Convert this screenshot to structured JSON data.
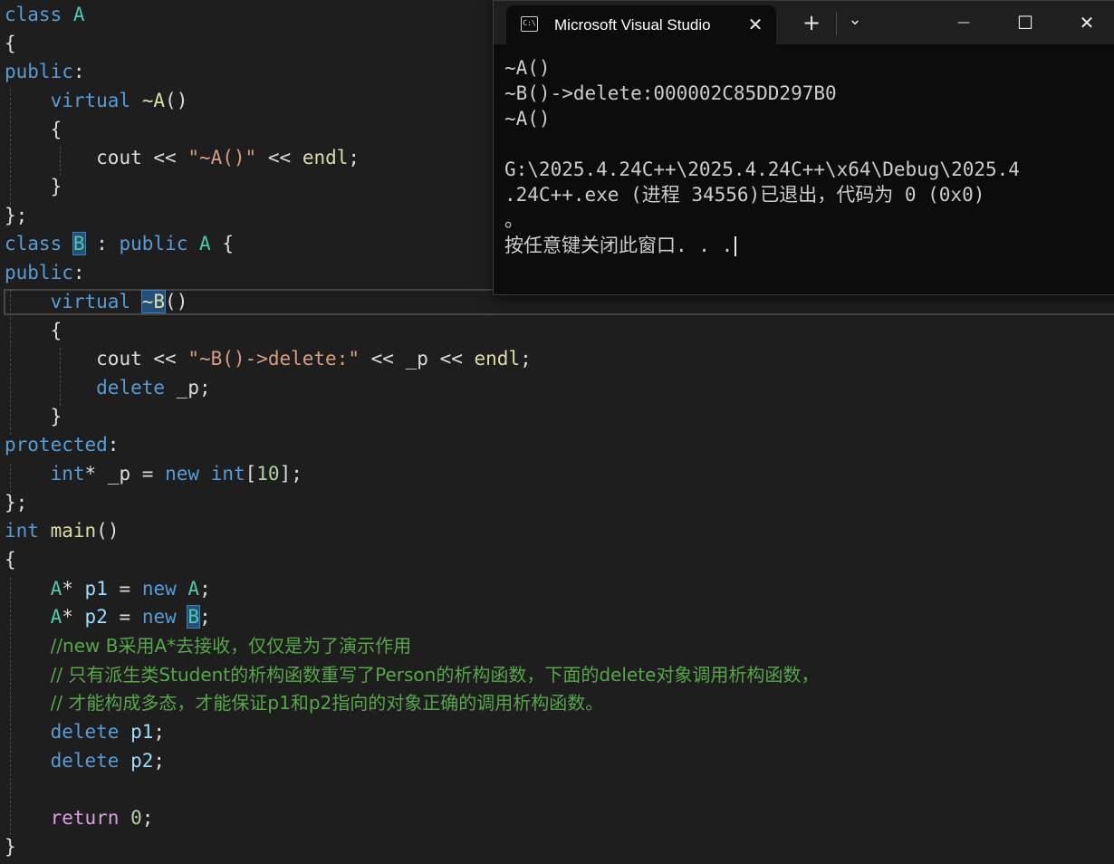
{
  "code": {
    "l1_kw": "class",
    "l1_name": "A",
    "l2": "{",
    "l3_kw": "public",
    "l3_colon": ":",
    "l4_kw": "virtual",
    "l4_fn": "~A",
    "l4_paren": "()",
    "l5": "{",
    "l6_cout": "cout",
    "l6_op": "<<",
    "l6_str": "\"~A()\"",
    "l6_op2": "<<",
    "l6_endl": "endl",
    "l6_semi": ";",
    "l7": "}",
    "l8": "};",
    "l9_kw": "class",
    "l9_name": "B",
    "l9_colon": ":",
    "l9_pub": "public",
    "l9_base": "A",
    "l9_brace": "{",
    "l10_kw": "public",
    "l10_colon": ":",
    "l11_kw": "virtual",
    "l11_fn": "~B",
    "l11_paren": "()",
    "l12": "{",
    "l13_cout": "cout",
    "l13_op": "<<",
    "l13_str": "\"~B()->delete:\"",
    "l13_op2": "<<",
    "l13_p": "_p",
    "l13_op3": "<<",
    "l13_endl": "endl",
    "l13_semi": ";",
    "l14_kw": "delete",
    "l14_p": "_p",
    "l14_semi": ";",
    "l15": "}",
    "l16_kw": "protected",
    "l16_colon": ":",
    "l17_type": "int",
    "l17_star": "*",
    "l17_var": "_p",
    "l17_eq": "=",
    "l17_new": "new",
    "l17_type2": "int",
    "l17_b1": "[",
    "l17_num": "10",
    "l17_b2": "];",
    "l18": "};",
    "l19_kw": "int",
    "l19_fn": "main",
    "l19_paren": "()",
    "l20": "{",
    "l21_cls": "A",
    "l21_star": "*",
    "l21_var": "p1",
    "l21_eq": "=",
    "l21_new": "new",
    "l21_cls2": "A",
    "l21_semi": ";",
    "l22_cls": "A",
    "l22_star": "*",
    "l22_var": "p2",
    "l22_eq": "=",
    "l22_new": "new",
    "l22_cls2": "B",
    "l22_semi": ";",
    "l23_comment": "//new B采用A*去接收，仅仅是为了演示作用",
    "l24_comment": "// 只有派生类Student的析构函数重写了Person的析构函数，下面的delete对象调用析构函数，",
    "l25_comment": "// 才能构成多态，才能保证p1和p2指向的对象正确的调用析构函数。",
    "l26_kw": "delete",
    "l26_var": "p1",
    "l26_semi": ";",
    "l27_kw": "delete",
    "l27_var": "p2",
    "l27_semi": ";",
    "l29_kw": "return",
    "l29_num": "0",
    "l29_semi": ";",
    "l30": "}"
  },
  "terminal": {
    "tab_icon_text": "C:\\",
    "tab_title": "Microsoft Visual Studio",
    "tab_close": "✕",
    "new_tab": "+",
    "dropdown": "⌄",
    "minimize": "—",
    "maximize": "☐",
    "close": "✕",
    "output": [
      "~A()",
      "~B()->delete:000002C85DD297B0",
      "~A()",
      "",
      "G:\\2025.4.24C++\\2025.4.24C++\\x64\\Debug\\2025.4",
      ".24C++.exe (进程 34556)已退出，代码为 0 (0x0)",
      "。",
      "按任意键关闭此窗口. . ."
    ]
  },
  "colors": {
    "editor_bg": "#1e1e1e",
    "keyword": "#569cd6",
    "type": "#4ec9b0",
    "function": "#dcdcaa",
    "string": "#d69d85",
    "variable": "#9cdcfe",
    "number": "#b5cea8",
    "comment": "#57a64a",
    "terminal_bg": "#0c0c0c",
    "selection": "#264f78"
  }
}
